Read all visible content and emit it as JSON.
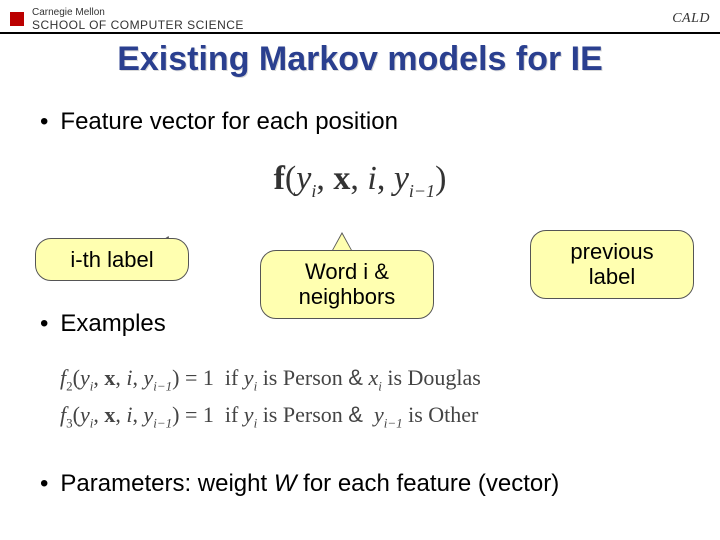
{
  "header": {
    "cmu_line": "Carnegie Mellon",
    "school": "SCHOOL OF COMPUTER SCIENCE",
    "right_logo_text": "CALD"
  },
  "title": "Existing Markov models for IE",
  "bullets": {
    "feature_vector": "Feature vector for each position",
    "examples": "Examples",
    "parameters_prefix": "Parameters:  weight ",
    "parameters_W": "W",
    "parameters_suffix": " for each feature (vector)"
  },
  "formula": {
    "fn": "f",
    "open": "(",
    "args": "y_i, x, i, y_{i-1}",
    "close": ")"
  },
  "callouts": {
    "left": "i-th label",
    "middle": "Word i & neighbors",
    "right": "previous label"
  },
  "example_lines": {
    "f2_lhs": "f₂(yᵢ, x, i, yᵢ₋₁) = 1",
    "f2_cond": " if yᵢ is Person & xᵢ is Douglas",
    "f3_lhs": "f₃(yᵢ, x, i, yᵢ₋₁) = 1",
    "f3_cond": " if yᵢ is Person &  yᵢ₋₁ is Other"
  }
}
